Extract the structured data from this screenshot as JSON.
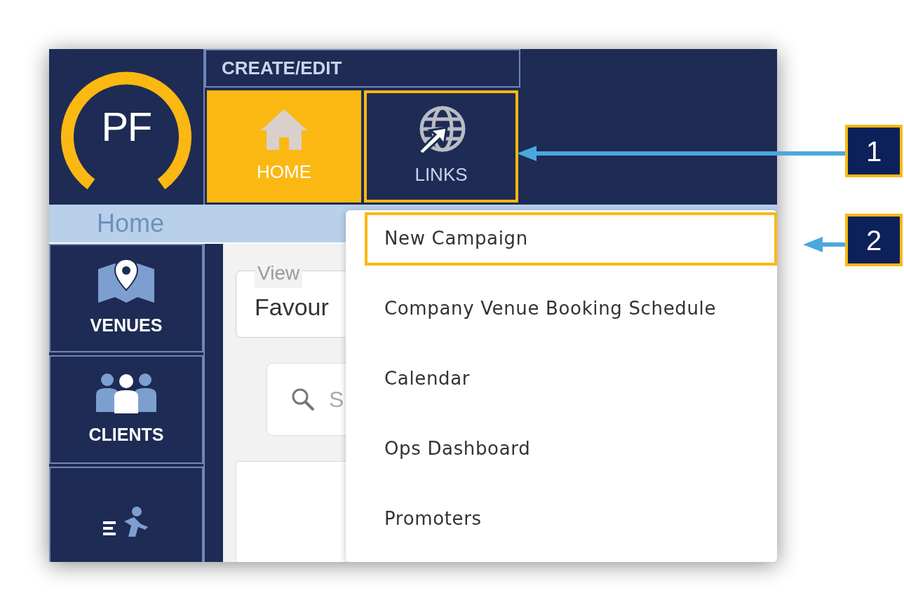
{
  "logo": {
    "text": "PF"
  },
  "ribbon": {
    "group_title": "CREATE/EDIT",
    "buttons": [
      {
        "label": "HOME",
        "kind": "house",
        "selected": true,
        "highlighted": false
      },
      {
        "label": "LINKS",
        "kind": "globe",
        "selected": false,
        "highlighted": true
      }
    ]
  },
  "breadcrumb": "Home",
  "sidebar": [
    {
      "label": "VENUES",
      "kind": "map"
    },
    {
      "label": "CLIENTS",
      "kind": "people"
    },
    {
      "kind": "runner"
    }
  ],
  "view_field": {
    "label": "View",
    "value": "Favour"
  },
  "search": {
    "placeholder": "S"
  },
  "links_menu": [
    {
      "label": "New Campaign",
      "highlighted": true
    },
    {
      "label": "Company Venue Booking Schedule",
      "highlighted": false
    },
    {
      "label": "Calendar",
      "highlighted": false
    },
    {
      "label": "Ops Dashboard",
      "highlighted": false
    },
    {
      "label": "Promoters",
      "highlighted": false
    }
  ],
  "callouts": [
    {
      "number": "1"
    },
    {
      "number": "2"
    }
  ]
}
